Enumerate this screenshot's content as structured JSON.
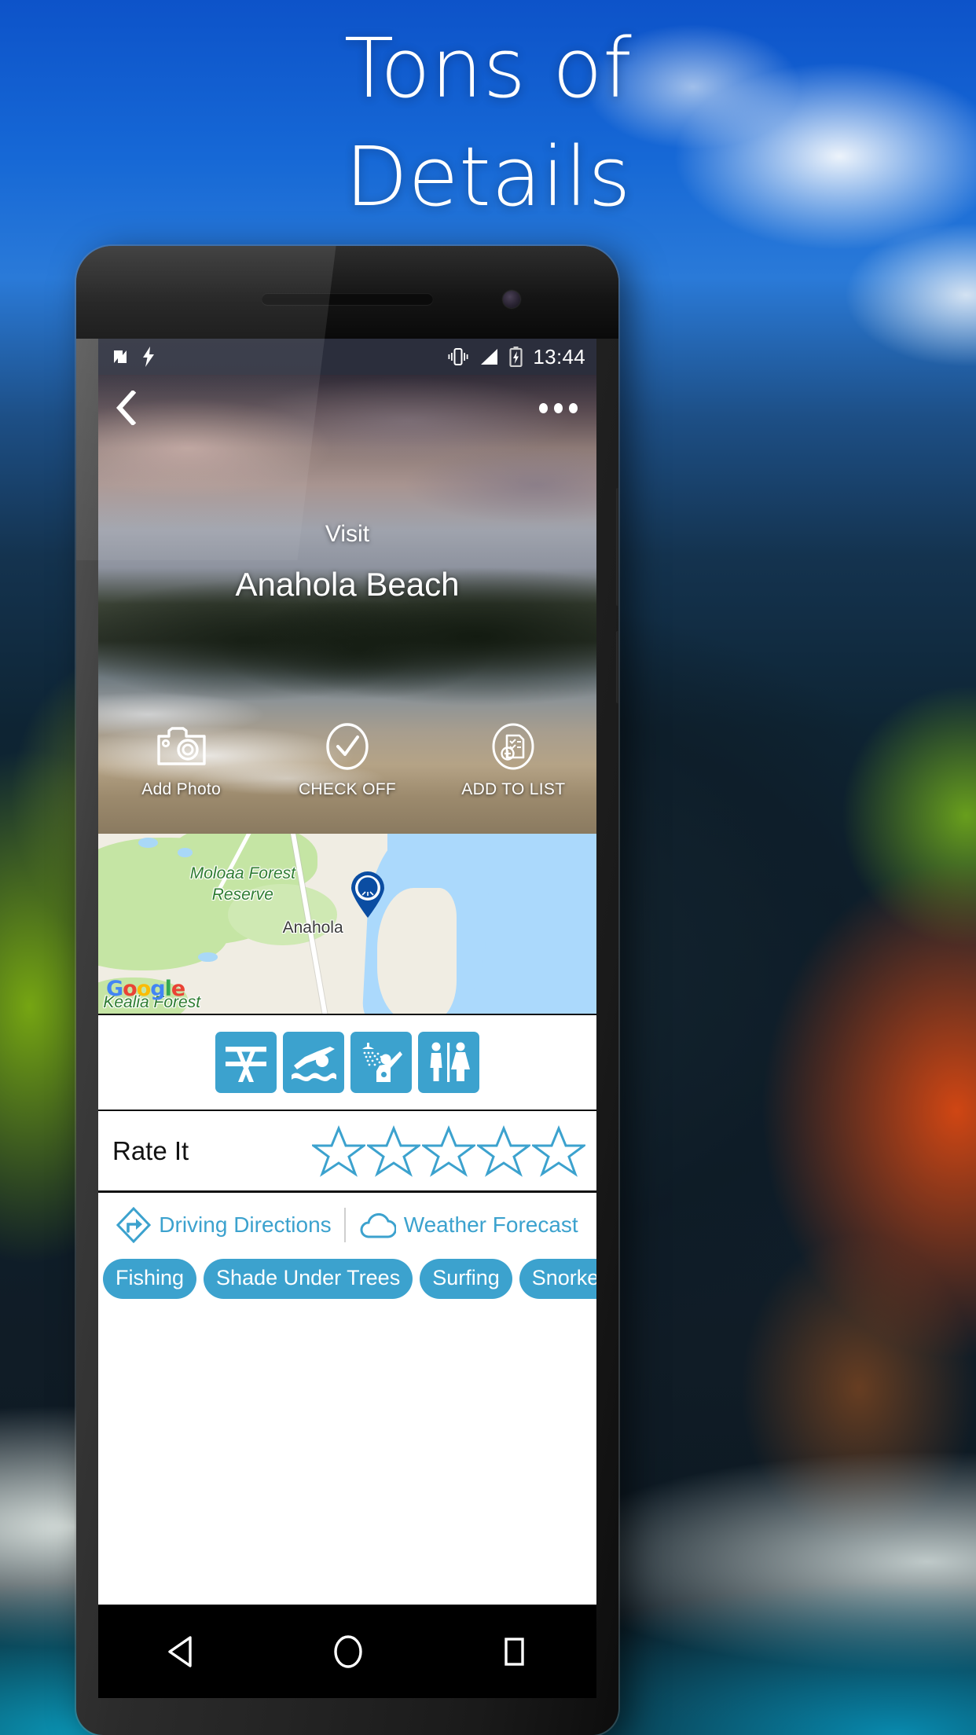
{
  "headline": {
    "line1": "Tons of",
    "line2": "Details"
  },
  "statusbar": {
    "icons": [
      "nfc-icon",
      "flash-icon",
      "vibrate-icon",
      "signal-icon",
      "battery-charging-icon"
    ],
    "clock": "13:44"
  },
  "hero": {
    "back_icon": "back-chevron-icon",
    "overflow_icon": "overflow-menu-icon",
    "kicker": "Visit",
    "place_name": "Anahola Beach"
  },
  "actions": [
    {
      "icon": "camera-icon",
      "label": "Add Photo"
    },
    {
      "icon": "check-circle-icon",
      "label": "CHECK OFF"
    },
    {
      "icon": "add-to-list-icon",
      "label": "ADD TO LIST"
    }
  ],
  "map": {
    "forest_label": "Moloaa Forest\nReserve",
    "town_label": "Anahola",
    "second_forest_label": "Kealia Forest",
    "attribution": "Google",
    "attribution_letters": [
      "G",
      "o",
      "o",
      "g",
      "l",
      "e"
    ],
    "marker_icon": "shell-map-pin-icon"
  },
  "amenities": [
    {
      "icon": "picnic-table-icon",
      "name": "Picnic Tables"
    },
    {
      "icon": "swimming-icon",
      "name": "Swimming"
    },
    {
      "icon": "shower-icon",
      "name": "Showers"
    },
    {
      "icon": "restroom-icon",
      "name": "Restrooms"
    }
  ],
  "rate": {
    "label": "Rate It",
    "stars_total": 5,
    "stars_filled": 0,
    "star_color": "#3ca2ce"
  },
  "links": [
    {
      "icon": "driving-directions-icon",
      "label": "Driving Directions"
    },
    {
      "icon": "weather-cloud-icon",
      "label": "Weather Forecast"
    }
  ],
  "tags": [
    "Fishing",
    "Shade Under Trees",
    "Surfing",
    "Snorkeling"
  ],
  "navbar": [
    {
      "icon": "android-back-icon"
    },
    {
      "icon": "android-home-icon"
    },
    {
      "icon": "android-recents-icon"
    }
  ],
  "colors": {
    "accent": "#3ca2ce",
    "statusbar_bg": "#2b2e3c",
    "map_water": "#abd9fc",
    "map_land": "#f0ede3",
    "map_green": "#c5e5a4",
    "map_label_green": "#2f7d32"
  }
}
